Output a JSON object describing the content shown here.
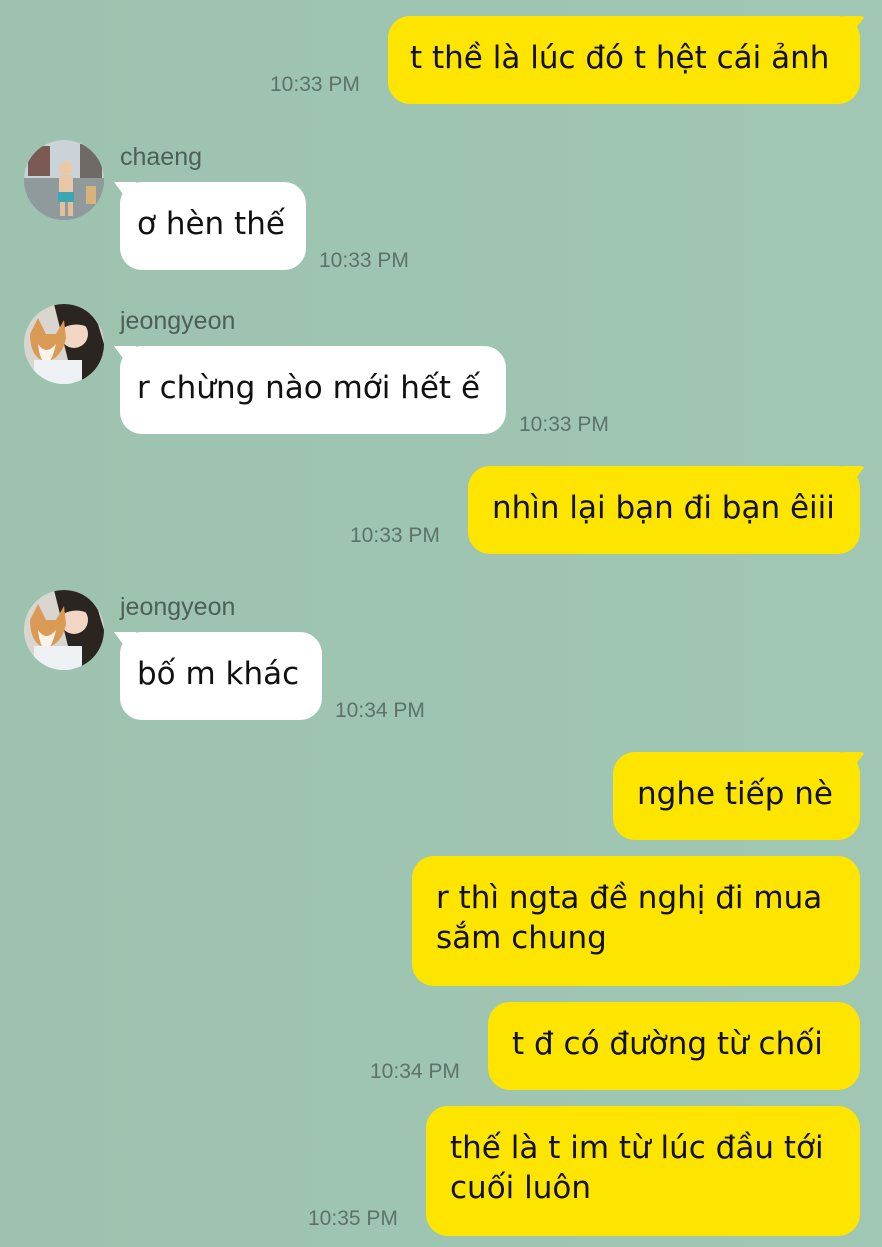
{
  "messages": [
    {
      "text": "t thề là lúc đó t hệt cái ảnh",
      "time": "10:33 PM"
    },
    {
      "sender": "chaeng",
      "text": "ơ hèn thế",
      "time": "10:33 PM"
    },
    {
      "sender": "jeongyeon",
      "text": "r chừng nào mới hết ế",
      "time": "10:33 PM"
    },
    {
      "text": "nhìn lại bạn đi bạn êiii",
      "time": "10:33 PM"
    },
    {
      "sender": "jeongyeon",
      "text": "bố m khác",
      "time": "10:34 PM"
    },
    {
      "text": "nghe tiếp nè"
    },
    {
      "text": "r thì ngta đề nghị đi mua sắm chung"
    },
    {
      "text": "t đ có đường từ chối",
      "time": "10:34 PM"
    },
    {
      "text": "thế là t im từ lúc đầu tới cuối luôn",
      "time": "10:35 PM"
    }
  ],
  "colors": {
    "background": "#9ec4b2",
    "my_bubble": "#fee500",
    "their_bubble": "#ffffff",
    "timestamp": "#5d7368"
  }
}
